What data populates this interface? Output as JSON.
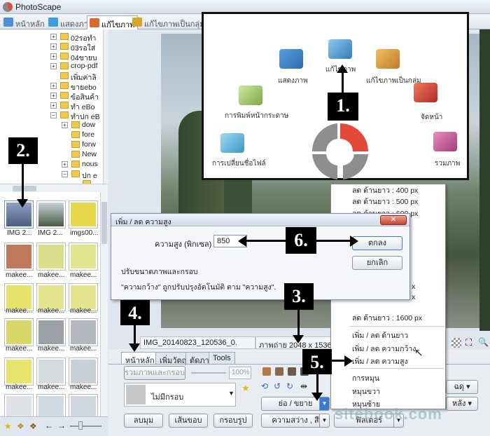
{
  "window": {
    "title": "PhotoScape"
  },
  "tabs": [
    {
      "label": "หน้าหลัก",
      "color": "#4a8fd8"
    },
    {
      "label": "แสดงภาพ",
      "color": "#3d9fd9"
    },
    {
      "label": "แก้ไขภาพ",
      "color": "#d9692d"
    },
    {
      "label": "แก้ไขภาพเป็นกลุ่ม",
      "color": "#d9a42d"
    }
  ],
  "tree": [
    {
      "label": "02รอทำ"
    },
    {
      "label": "03รอใส่"
    },
    {
      "label": "04ขายบ"
    },
    {
      "label": "crop-pdf"
    },
    {
      "label": "เพิ่มค่าลิ"
    },
    {
      "label": "ขายebo"
    },
    {
      "label": "ข้อสินค้า"
    },
    {
      "label": "ทำ eBo"
    },
    {
      "label": "ทำปก eB"
    },
    {
      "label": "dow"
    },
    {
      "label": "fore"
    },
    {
      "label": "forw"
    },
    {
      "label": "New"
    },
    {
      "label": "nous"
    },
    {
      "label": "ปก e"
    },
    {
      "label": "แ"
    }
  ],
  "thumbs": {
    "row1": [
      "IMG 2...",
      "IMG 2...",
      "imgs00..."
    ],
    "makee": "makee..."
  },
  "status": {
    "file": "IMG_20140823_120536_0.",
    "size": "ภาพถ่าย 2048 x 1536"
  },
  "bottom_tabs": [
    "หน้าหลัก",
    "เพิ่มวัตถุ",
    "ตัดภาพ",
    "Tools"
  ],
  "bottom": {
    "merge_button": "รวมภาพและกรอบ",
    "percent": "100%",
    "frame_select": "ไม่มีกรอบ",
    "round_button": "ลบมุม",
    "border_button": "เส้นขอบ",
    "frame_button": "กรอบรูป",
    "resize_button": "ย่อ / ขยาย",
    "brightness_button": "ความสว่าง , สี",
    "filter_button": "ฟิลเตอร์",
    "right_select_1": "ฉดุ",
    "right_select_2": "หลัง"
  },
  "menu": {
    "items_top": [
      "ลด ด้านยาว : 400 px",
      "ลด ด้านยาว : 500 px",
      "ลด ด้านยาว : 600 px"
    ],
    "items_mid": [
      "ลด ด้านยาว : 1600 px"
    ],
    "items_resize": [
      "เพิ่ม / ลด ด้านยาว",
      "เพิ่ม / ลด ความกว้าง",
      "เพิ่ม / ลด ความสูง"
    ],
    "items_rotate": [
      "การหมุน",
      "หมุนขวา",
      "หมุนซ้าย"
    ]
  },
  "popup": {
    "items": [
      {
        "label": "แสดงภาพ",
        "color": "#3b8fd6"
      },
      {
        "label": "แก้ไขภาพ",
        "color": "#5aa8d8"
      },
      {
        "label": "แก้ไขภาพเป็นกลุ่ม",
        "color": "#e0a13a"
      },
      {
        "label": "การพิมพ์หน้ากระดาษ",
        "color": "#9bc25a"
      },
      {
        "label": "จัดหน้า",
        "color": "#d84a3a"
      },
      {
        "label": "การเปลี่ยนชื่อไฟล์",
        "color": "#4ab0d8"
      },
      {
        "label": "รวมภาพ",
        "color": "#c04a8a"
      }
    ],
    "logo_colors": {
      "red": "#e34a3a",
      "gray": "#8e8e8e"
    }
  },
  "dialog": {
    "title": "เพิ่ม / ลด ความสูง",
    "height_label": "ความสูง (พิกเซล)",
    "height_value": "850",
    "ok": "ตกลง",
    "cancel": "ยกเลิก",
    "note1": "ปรับขนาดภาพและกรอบ",
    "note2": "\"ความกว้าง\" ถูกปรับปรุงอัตโนมัติ ตาม  \"ความสูง\"."
  },
  "steps": [
    "1.",
    "2.",
    "3.",
    "4.",
    "5.",
    "6."
  ],
  "watermark": "sitebook.com"
}
